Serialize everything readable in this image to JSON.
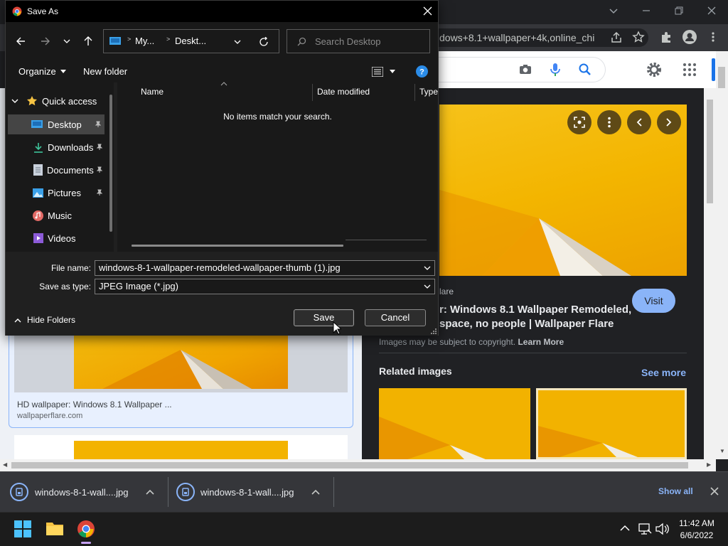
{
  "browser": {
    "omnibox_text": "dows+8.1+wallpaper+4k,online_chi",
    "panel": {
      "source_site": "lare",
      "title_line1": "r: Windows 8.1 Wallpaper Remodeled,",
      "title_line2": "space, no people | Wallpaper Flare",
      "visit_label": "Visit",
      "copyright_text": "Images may be subject to copyright.",
      "learn_more": "Learn More",
      "related_heading": "Related images",
      "see_more": "See more"
    },
    "result_card": {
      "title": "HD wallpaper: Windows 8.1 Wallpaper ...",
      "site": "wallpaperflare.com"
    }
  },
  "downloads": {
    "items": [
      {
        "name": "windows-8-1-wall....jpg"
      },
      {
        "name": "windows-8-1-wall....jpg"
      }
    ],
    "show_all": "Show all"
  },
  "taskbar": {
    "time": "11:42 AM",
    "date": "6/6/2022"
  },
  "dialog": {
    "title": "Save As",
    "address": {
      "segments": [
        "My...",
        "Deskt..."
      ]
    },
    "search_placeholder": "Search Desktop",
    "organize": "Organize",
    "new_folder": "New folder",
    "nav": {
      "quick_access": "Quick access",
      "items": [
        {
          "label": "Desktop",
          "pinned": true,
          "selected": true
        },
        {
          "label": "Downloads",
          "pinned": true
        },
        {
          "label": "Documents",
          "pinned": true
        },
        {
          "label": "Pictures",
          "pinned": true
        },
        {
          "label": "Music",
          "pinned": false
        },
        {
          "label": "Videos",
          "pinned": false
        }
      ]
    },
    "columns": {
      "name": "Name",
      "date": "Date modified",
      "type": "Type"
    },
    "empty_message": "No items match your search.",
    "file_name_label": "File name:",
    "file_name_value": "windows-8-1-wallpaper-remodeled-wallpaper-thumb (1).jpg",
    "save_type_label": "Save as type:",
    "save_type_value": "JPEG Image (*.jpg)",
    "hide_folders": "Hide Folders",
    "save_label": "Save",
    "cancel_label": "Cancel"
  }
}
